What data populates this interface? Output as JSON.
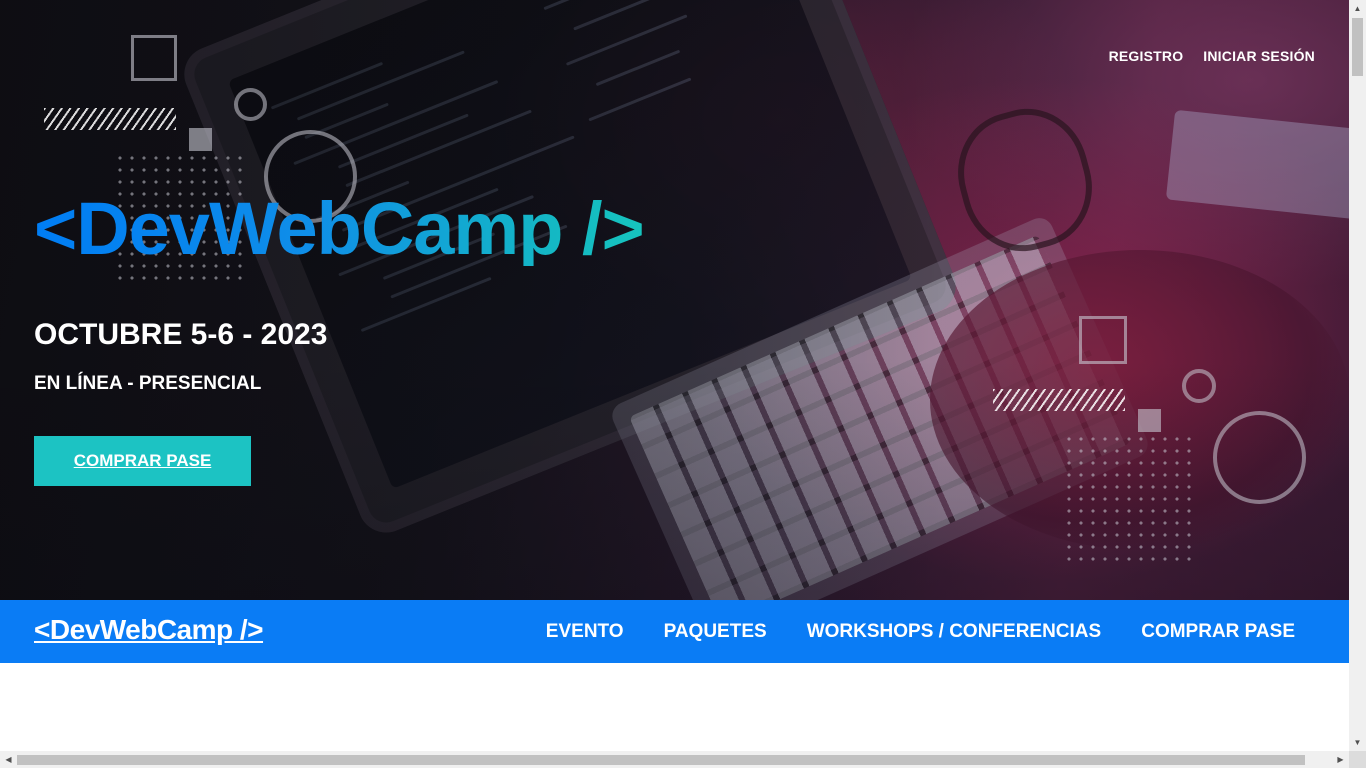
{
  "header": {
    "auth_links": {
      "register": "REGISTRO",
      "login": "INICIAR SESIÓN"
    },
    "logo": "<DevWebCamp />",
    "date": "OCTUBRE 5-6 - 2023",
    "mode": "EN LÍNEA - PRESENCIAL",
    "cta": "COMPRAR PASE"
  },
  "navbar": {
    "logo": "<DevWebCamp />",
    "links": [
      {
        "label": "EVENTO"
      },
      {
        "label": "PAQUETES"
      },
      {
        "label": "WORKSHOPS / CONFERENCIAS"
      },
      {
        "label": "COMPRAR PASE"
      }
    ]
  },
  "colors": {
    "brand_blue": "#0a7cf5",
    "accent_teal": "#1cc3c3",
    "text_white": "#ffffff"
  },
  "icons": {
    "scroll_up": "triangle-up-icon",
    "scroll_down": "triangle-down-icon",
    "scroll_left": "triangle-left-icon",
    "scroll_right": "triangle-right-icon"
  }
}
